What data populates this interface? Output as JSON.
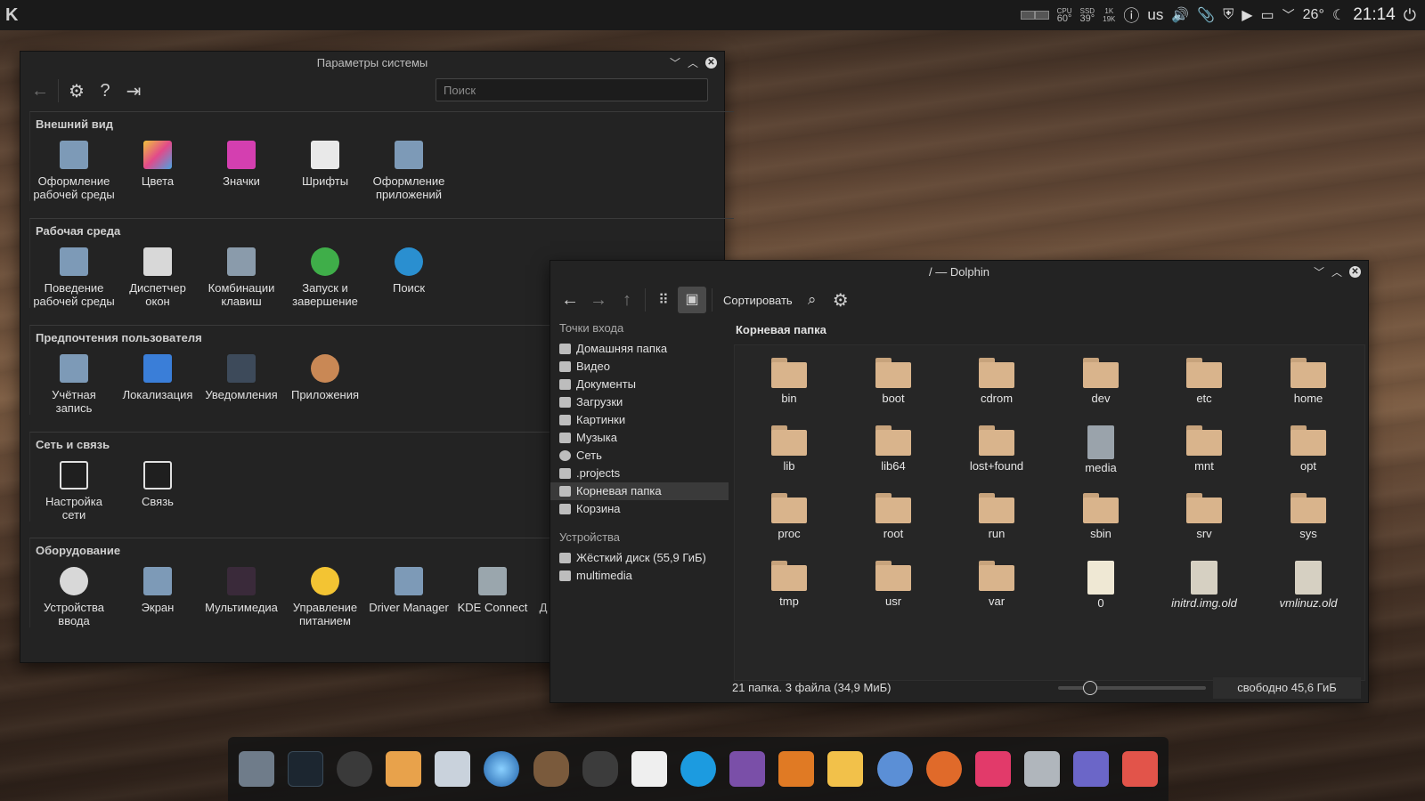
{
  "panel": {
    "launcher_icon": "kde-logo",
    "cpu_label": "CPU",
    "ssd_label": "SSD",
    "cpu_temp": "60°",
    "ssd_temp": "39°",
    "net_up": "1K",
    "net_down": "19K",
    "keyboard_layout": "us",
    "weather_temp": "26°",
    "time": "21:14"
  },
  "settings": {
    "title": "Параметры системы",
    "search_placeholder": "Поиск",
    "sections": [
      {
        "title": "Внешний вид",
        "items": [
          "Оформление рабочей среды",
          "Цвета",
          "Значки",
          "Шрифты",
          "Оформление приложений"
        ]
      },
      {
        "title": "Рабочая среда",
        "items": [
          "Поведение рабочей среды",
          "Диспетчер окон",
          "Комбинации клавиш",
          "Запуск и завершение",
          "Поиск"
        ]
      },
      {
        "title": "Предпочтения пользователя",
        "items": [
          "Учётная запись",
          "Локализация",
          "Уведомления",
          "Приложения"
        ]
      },
      {
        "title": "Сеть и связь",
        "items": [
          "Настройка сети",
          "Связь"
        ]
      },
      {
        "title": "Оборудование",
        "items": [
          "Устройства ввода",
          "Экран",
          "Мультимедиа",
          "Управление питанием",
          "Driver Manager",
          "KDE Connect",
          "Д"
        ]
      }
    ]
  },
  "dolphin": {
    "title": "/ — Dolphin",
    "sort_label": "Сортировать",
    "places_header": "Точки входа",
    "places": [
      "Домашняя папка",
      "Видео",
      "Документы",
      "Загрузки",
      "Картинки",
      "Музыка",
      "Сеть",
      ".projects",
      "Корневая папка",
      "Корзина"
    ],
    "devices_header": "Устройства",
    "devices": [
      "Жёсткий диск (55,9 ГиБ)",
      "multimedia"
    ],
    "location_label": "Корневая папка",
    "files": [
      "bin",
      "boot",
      "cdrom",
      "dev",
      "etc",
      "home",
      "lib",
      "lib64",
      "lost+found",
      "media",
      "mnt",
      "opt",
      "proc",
      "root",
      "run",
      "sbin",
      "srv",
      "sys",
      "tmp",
      "usr",
      "var",
      "0",
      "initrd.img.old",
      "vmlinuz.old"
    ],
    "status": "21 папка. 3 файла (34,9 МиБ)",
    "free_space": "свободно 45,6 ГиБ"
  },
  "dock": {
    "icons": [
      "file-manager-icon",
      "terminal-icon",
      "github-icon",
      "downloader-icon",
      "settings-icon",
      "browser-icon",
      "krita-icon",
      "inkscape-icon",
      "editor-icon",
      "torrent-icon",
      "viber-icon",
      "rss-icon",
      "mail-icon",
      "chromium-icon",
      "audio-icon",
      "media-player-icon",
      "files-icon",
      "pointer-icon",
      "photos-icon"
    ]
  }
}
